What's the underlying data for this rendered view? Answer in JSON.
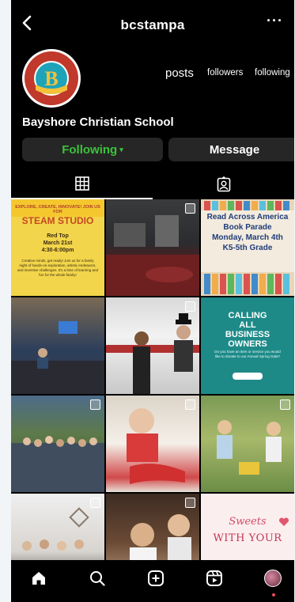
{
  "header": {
    "username": "bcstampa",
    "back_icon": "chevron-left-icon",
    "more_label": "···"
  },
  "profile": {
    "display_name": "Bayshore Christian School",
    "logo_letter": "B",
    "logo_ring_text": "BAYSHORE CHRISTIAN SCHOOL",
    "logo_bottom_text": "TAMPA • FLORIDA",
    "stats": {
      "posts_label": "posts",
      "followers_label": "followers",
      "following_label": "following"
    }
  },
  "actions": {
    "following_label": "Following",
    "message_label": "Message"
  },
  "tabs": [
    {
      "name": "grid",
      "icon": "grid-icon",
      "active": true
    },
    {
      "name": "tagged",
      "icon": "tagged-person-icon",
      "active": false
    }
  ],
  "posts": {
    "p1": {
      "header_text": "EXPLORE, CREATE, INNOVATE! JOIN US FOR",
      "title": "STEAM STUDIO",
      "details": "Red Top\nMarch 21st\n4:30-6:00pm",
      "body": "Creative minds, get ready! Join us for a family night of hands-on exploration, artistic endeavors, and inventive challenges. It's a time of learning and fun for the whole family!"
    },
    "p3": {
      "text": "Read Across America\nBook Parade\nMonday, March 4th\nK5-5th Grade"
    },
    "p6": {
      "text": "CALLING\nALL\nBUSINESS\nOWNERS",
      "small": "Do you have an item or service you would like to donate to our Annual Spring Gala?"
    },
    "p12": {
      "line1": "Sweets",
      "line2": "WITH YOUR"
    }
  },
  "bottom_nav": [
    {
      "name": "home",
      "icon": "home-icon"
    },
    {
      "name": "search",
      "icon": "search-icon"
    },
    {
      "name": "create",
      "icon": "plus-square-icon"
    },
    {
      "name": "reels",
      "icon": "reels-icon"
    },
    {
      "name": "profile",
      "icon": "profile-avatar-icon"
    }
  ],
  "colors": {
    "background": "#000000",
    "following_text": "#3ac43a",
    "button_bg": "#262626",
    "notification_dot": "#ed4956"
  }
}
